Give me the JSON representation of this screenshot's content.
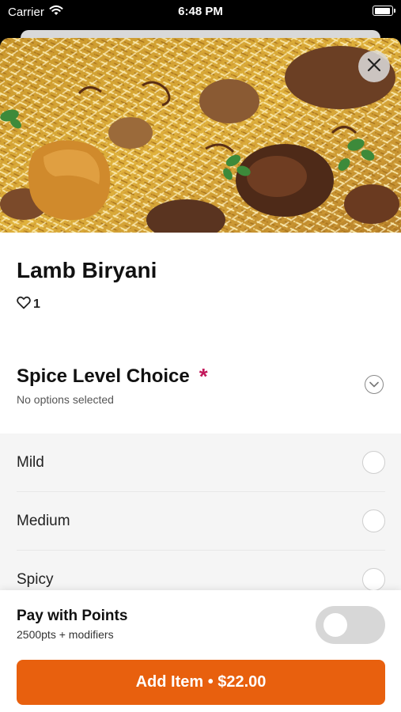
{
  "status_bar": {
    "carrier": "Carrier",
    "time": "6:48 PM"
  },
  "item": {
    "name": "Lamb Biryani",
    "likes": "1"
  },
  "modifier_group": {
    "title": "Spice Level Choice",
    "required_marker": "*",
    "subtitle": "No options selected",
    "options": [
      {
        "label": "Mild"
      },
      {
        "label": "Medium"
      },
      {
        "label": "Spicy"
      }
    ]
  },
  "points": {
    "title": "Pay with Points",
    "subtitle": "2500pts + modifiers",
    "enabled": false
  },
  "add_button": {
    "label": "Add Item • $22.00"
  },
  "colors": {
    "accent": "#e8600e",
    "required": "#c2185b",
    "options_bg": "#f5f5f5"
  }
}
